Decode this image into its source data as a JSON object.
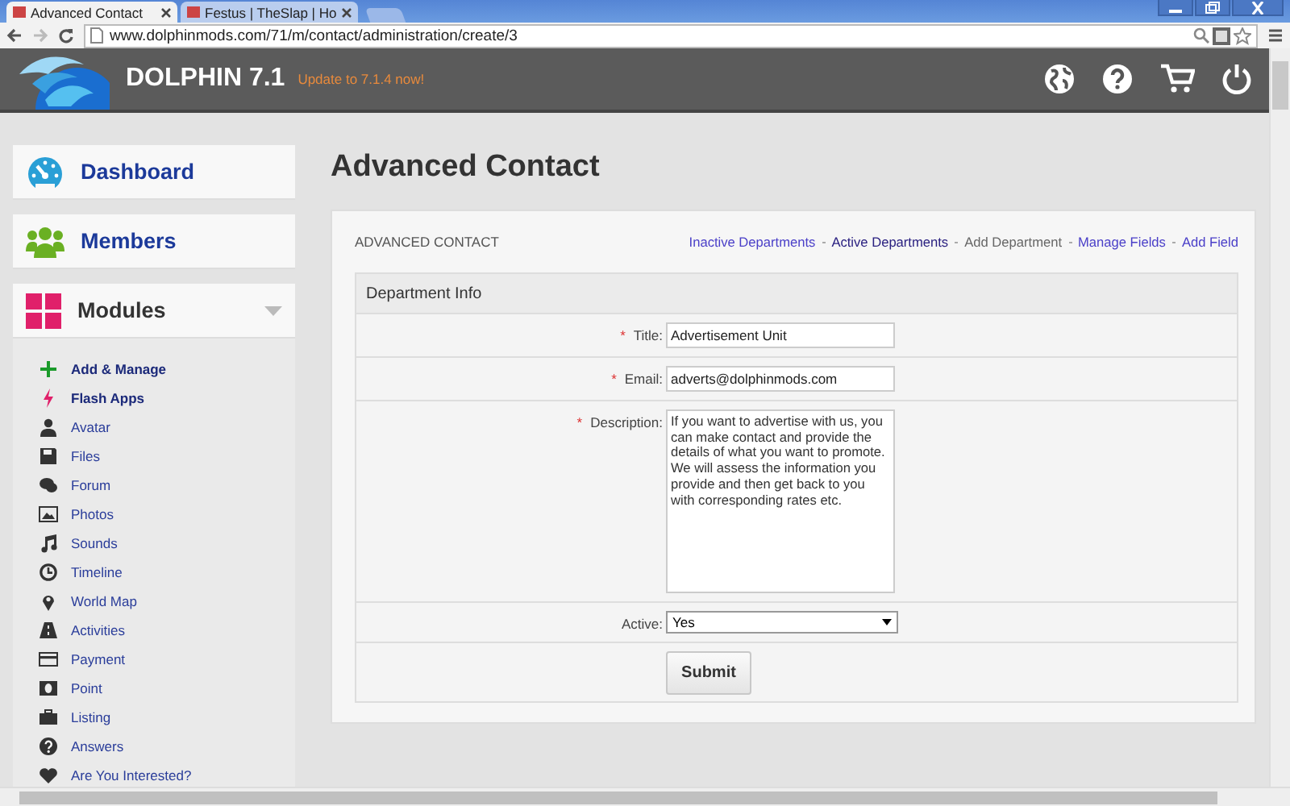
{
  "browser": {
    "tabs": [
      {
        "label": "Advanced Contact",
        "selected": true
      },
      {
        "label": "Festus | TheSlap | Ho",
        "selected": false
      }
    ],
    "url": "www.dolphinmods.com/71/m/contact/administration/create/3"
  },
  "header": {
    "brand": "DOLPHIN 7.1",
    "update": "Update to 7.1.4 now!"
  },
  "sidebar": {
    "sections": [
      {
        "label": "Dashboard"
      },
      {
        "label": "Members"
      },
      {
        "label": "Modules",
        "expanded": true,
        "items": [
          {
            "label": "Add & Manage",
            "kind": "action"
          },
          {
            "label": "Flash Apps",
            "kind": "action"
          },
          {
            "label": "Avatar",
            "kind": "module"
          },
          {
            "label": "Files",
            "kind": "module"
          },
          {
            "label": "Forum",
            "kind": "module"
          },
          {
            "label": "Photos",
            "kind": "module"
          },
          {
            "label": "Sounds",
            "kind": "module"
          },
          {
            "label": "Timeline",
            "kind": "module"
          },
          {
            "label": "World Map",
            "kind": "module"
          },
          {
            "label": "Activities",
            "kind": "module"
          },
          {
            "label": "Payment",
            "kind": "module"
          },
          {
            "label": "Point",
            "kind": "module"
          },
          {
            "label": "Listing",
            "kind": "module"
          },
          {
            "label": "Answers",
            "kind": "module"
          },
          {
            "label": "Are You Interested?",
            "kind": "module"
          }
        ]
      }
    ]
  },
  "page_title": "Advanced Contact",
  "card": {
    "title": "ADVANCED CONTACT",
    "links": [
      {
        "label": "Inactive Departments",
        "kind": "link"
      },
      {
        "label": "Active Departments",
        "kind": "visited"
      },
      {
        "label": "Add Department",
        "kind": "current"
      },
      {
        "label": "Manage Fields",
        "kind": "link"
      },
      {
        "label": "Add Field",
        "kind": "link"
      }
    ],
    "section": "Department Info",
    "fields": [
      {
        "label": "Title:",
        "required": true,
        "kind": "text",
        "value": "Advertisement Unit"
      },
      {
        "label": "Email:",
        "required": true,
        "kind": "text",
        "value": "adverts@dolphinmods.com"
      },
      {
        "label": "Description:",
        "required": true,
        "kind": "textarea",
        "value": "If you want to advertise with us, you can make contact and provide the details of what you want to promote. We will assess the information you provide and then get back to you with corresponding rates etc."
      },
      {
        "label": "Active:",
        "required": false,
        "kind": "select",
        "value": "Yes"
      }
    ],
    "required_mark": "*",
    "submit": "Submit"
  }
}
